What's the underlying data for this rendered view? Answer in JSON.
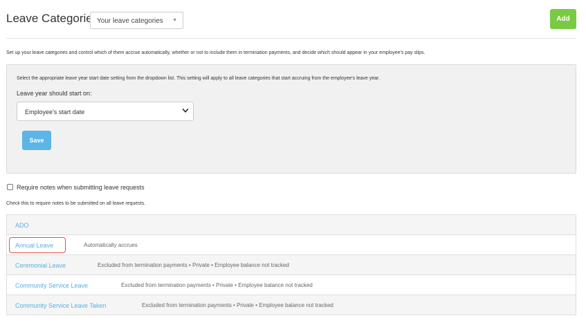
{
  "header": {
    "title": "Leave Categories",
    "category_filter": "Your leave categories",
    "add_label": "Add"
  },
  "intro_text": "Set up your leave categories and control which of them accrue automatically, whether or not to include them in termination payments, and decide which should appear in your employee's pay slips.",
  "panel": {
    "help_text": "Select the appropriate leave year start date setting from the dropdown list. This setting will apply to all leave categories that start accruing from the employee's leave year.",
    "label": "Leave year should start on:",
    "selected_option": "Employee's start date",
    "save_label": "Save"
  },
  "notes": {
    "checkbox_label": "Require notes when submitting leave requests",
    "checked": false,
    "help_text": "Check this to require notes to be submitted on all leave requests."
  },
  "categories": [
    {
      "name": "ADO",
      "details": ""
    },
    {
      "name": "Annual Leave",
      "details": "Automatically accrues",
      "highlighted": true
    },
    {
      "name": "Ceremonial Leave",
      "details": "Excluded from termination payments • Private • Employee balance not tracked"
    },
    {
      "name": "Community Service Leave",
      "details": "Excluded from termination payments • Private • Employee balance not tracked"
    },
    {
      "name": "Community Service Leave Taken",
      "details": "Excluded from termination payments • Private • Employee balance not tracked"
    }
  ],
  "colors": {
    "add_button": "#7ac943",
    "save_button": "#5bb5e6",
    "link": "#58b0e0",
    "highlight_border": "#d9534f"
  }
}
